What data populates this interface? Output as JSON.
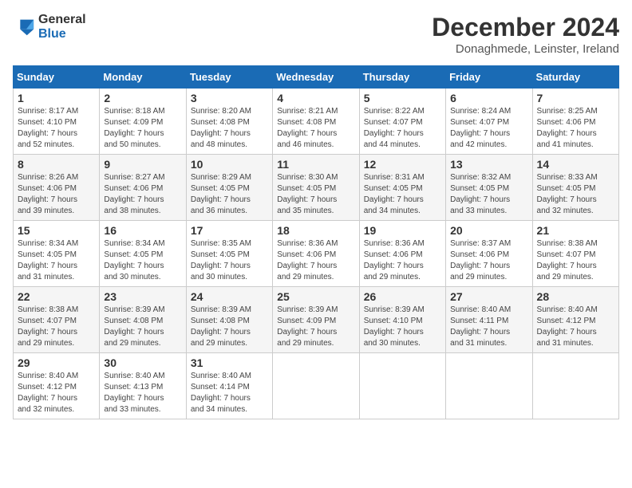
{
  "header": {
    "logo_general": "General",
    "logo_blue": "Blue",
    "month_title": "December 2024",
    "location": "Donaghmede, Leinster, Ireland"
  },
  "days_of_week": [
    "Sunday",
    "Monday",
    "Tuesday",
    "Wednesday",
    "Thursday",
    "Friday",
    "Saturday"
  ],
  "weeks": [
    [
      {
        "day": "1",
        "sunrise": "8:17 AM",
        "sunset": "4:10 PM",
        "daylight": "7 hours and 52 minutes."
      },
      {
        "day": "2",
        "sunrise": "8:18 AM",
        "sunset": "4:09 PM",
        "daylight": "7 hours and 50 minutes."
      },
      {
        "day": "3",
        "sunrise": "8:20 AM",
        "sunset": "4:08 PM",
        "daylight": "7 hours and 48 minutes."
      },
      {
        "day": "4",
        "sunrise": "8:21 AM",
        "sunset": "4:08 PM",
        "daylight": "7 hours and 46 minutes."
      },
      {
        "day": "5",
        "sunrise": "8:22 AM",
        "sunset": "4:07 PM",
        "daylight": "7 hours and 44 minutes."
      },
      {
        "day": "6",
        "sunrise": "8:24 AM",
        "sunset": "4:07 PM",
        "daylight": "7 hours and 42 minutes."
      },
      {
        "day": "7",
        "sunrise": "8:25 AM",
        "sunset": "4:06 PM",
        "daylight": "7 hours and 41 minutes."
      }
    ],
    [
      {
        "day": "8",
        "sunrise": "8:26 AM",
        "sunset": "4:06 PM",
        "daylight": "7 hours and 39 minutes."
      },
      {
        "day": "9",
        "sunrise": "8:27 AM",
        "sunset": "4:06 PM",
        "daylight": "7 hours and 38 minutes."
      },
      {
        "day": "10",
        "sunrise": "8:29 AM",
        "sunset": "4:05 PM",
        "daylight": "7 hours and 36 minutes."
      },
      {
        "day": "11",
        "sunrise": "8:30 AM",
        "sunset": "4:05 PM",
        "daylight": "7 hours and 35 minutes."
      },
      {
        "day": "12",
        "sunrise": "8:31 AM",
        "sunset": "4:05 PM",
        "daylight": "7 hours and 34 minutes."
      },
      {
        "day": "13",
        "sunrise": "8:32 AM",
        "sunset": "4:05 PM",
        "daylight": "7 hours and 33 minutes."
      },
      {
        "day": "14",
        "sunrise": "8:33 AM",
        "sunset": "4:05 PM",
        "daylight": "7 hours and 32 minutes."
      }
    ],
    [
      {
        "day": "15",
        "sunrise": "8:34 AM",
        "sunset": "4:05 PM",
        "daylight": "7 hours and 31 minutes."
      },
      {
        "day": "16",
        "sunrise": "8:34 AM",
        "sunset": "4:05 PM",
        "daylight": "7 hours and 30 minutes."
      },
      {
        "day": "17",
        "sunrise": "8:35 AM",
        "sunset": "4:05 PM",
        "daylight": "7 hours and 30 minutes."
      },
      {
        "day": "18",
        "sunrise": "8:36 AM",
        "sunset": "4:06 PM",
        "daylight": "7 hours and 29 minutes."
      },
      {
        "day": "19",
        "sunrise": "8:36 AM",
        "sunset": "4:06 PM",
        "daylight": "7 hours and 29 minutes."
      },
      {
        "day": "20",
        "sunrise": "8:37 AM",
        "sunset": "4:06 PM",
        "daylight": "7 hours and 29 minutes."
      },
      {
        "day": "21",
        "sunrise": "8:38 AM",
        "sunset": "4:07 PM",
        "daylight": "7 hours and 29 minutes."
      }
    ],
    [
      {
        "day": "22",
        "sunrise": "8:38 AM",
        "sunset": "4:07 PM",
        "daylight": "7 hours and 29 minutes."
      },
      {
        "day": "23",
        "sunrise": "8:39 AM",
        "sunset": "4:08 PM",
        "daylight": "7 hours and 29 minutes."
      },
      {
        "day": "24",
        "sunrise": "8:39 AM",
        "sunset": "4:08 PM",
        "daylight": "7 hours and 29 minutes."
      },
      {
        "day": "25",
        "sunrise": "8:39 AM",
        "sunset": "4:09 PM",
        "daylight": "7 hours and 29 minutes."
      },
      {
        "day": "26",
        "sunrise": "8:39 AM",
        "sunset": "4:10 PM",
        "daylight": "7 hours and 30 minutes."
      },
      {
        "day": "27",
        "sunrise": "8:40 AM",
        "sunset": "4:11 PM",
        "daylight": "7 hours and 31 minutes."
      },
      {
        "day": "28",
        "sunrise": "8:40 AM",
        "sunset": "4:12 PM",
        "daylight": "7 hours and 31 minutes."
      }
    ],
    [
      {
        "day": "29",
        "sunrise": "8:40 AM",
        "sunset": "4:12 PM",
        "daylight": "7 hours and 32 minutes."
      },
      {
        "day": "30",
        "sunrise": "8:40 AM",
        "sunset": "4:13 PM",
        "daylight": "7 hours and 33 minutes."
      },
      {
        "day": "31",
        "sunrise": "8:40 AM",
        "sunset": "4:14 PM",
        "daylight": "7 hours and 34 minutes."
      },
      null,
      null,
      null,
      null
    ]
  ],
  "labels": {
    "sunrise": "Sunrise:",
    "sunset": "Sunset:",
    "daylight": "Daylight:"
  }
}
